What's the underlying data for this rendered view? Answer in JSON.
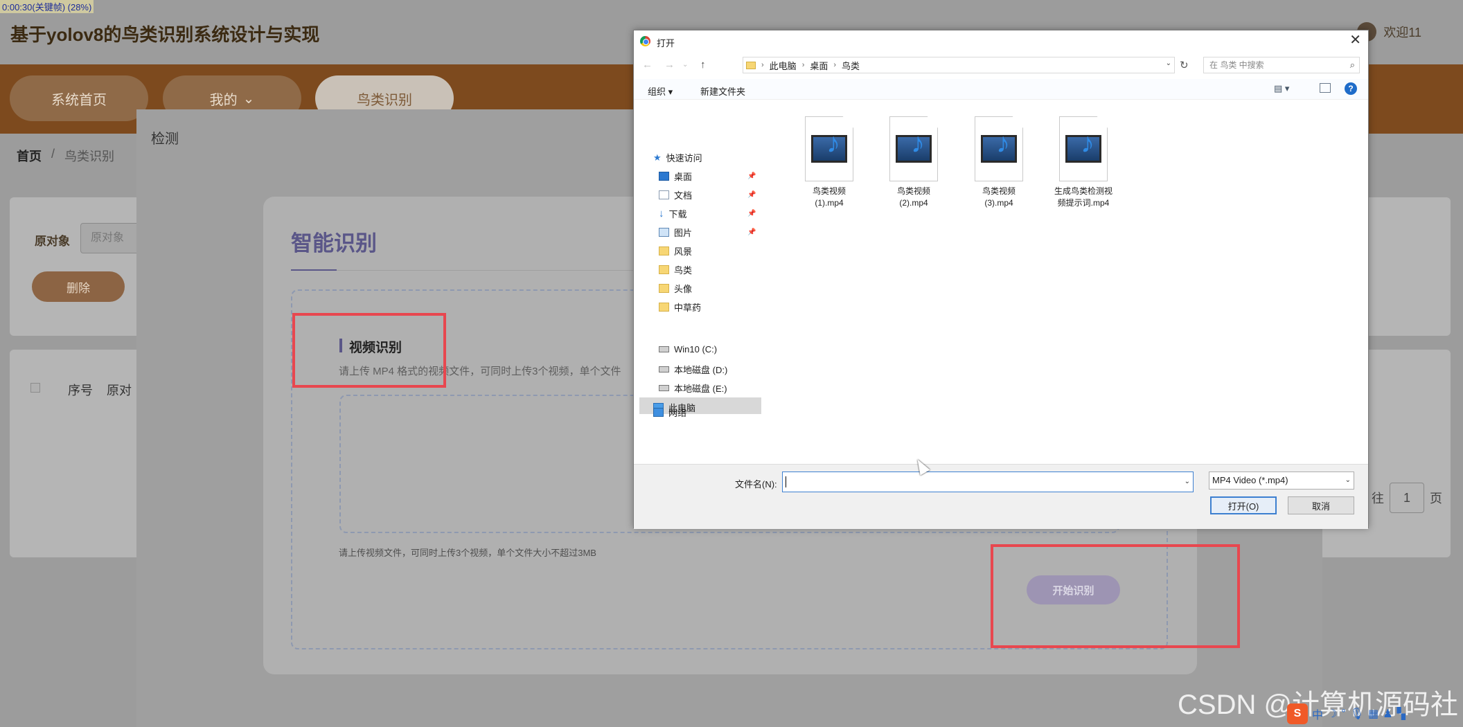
{
  "recording_label": "0:00:30(关键帧) (28%)",
  "app": {
    "title": "基于yolov8的鸟类识别系统设计与实现",
    "user_greeting": "欢迎11",
    "nav": [
      "系统首页",
      "我的",
      "鸟类识别"
    ],
    "nav_active": "鸟类识别",
    "breadcrumb": {
      "home": "首页",
      "sep": "/",
      "current": "鸟类识别"
    },
    "filter": {
      "label": "原对象",
      "placeholder": "原对象"
    },
    "delete_button": "删除",
    "table_headers": {
      "seq": "序号",
      "orig": "原对"
    },
    "pager": {
      "goto": "往",
      "page": "1",
      "suffix": "页"
    }
  },
  "detect_dialog": {
    "title": "检测",
    "smart_title": "智能识别",
    "video_label": "视频识别",
    "video_desc": "请上传 MP4 格式的视频文件，可同时上传3个视频，单个文件",
    "hint": "请上传视频文件，可同时上传3个视频，单个文件大小不超过3MB",
    "start_button": "开始识别",
    "highlight_color": "#e8474f"
  },
  "file_dialog": {
    "title": "打开",
    "path": [
      "此电脑",
      "桌面",
      "鸟类"
    ],
    "search_placeholder": "在 鸟类 中搜索",
    "toolbar": {
      "organize": "组织 ▾",
      "new_folder": "新建文件夹"
    },
    "nav": {
      "quick_access": "快速访问",
      "desktop": "桌面",
      "documents": "文档",
      "downloads": "下载",
      "pictures": "图片",
      "f1": "风景",
      "f2": "鸟类",
      "f3": "头像",
      "f4": "中草药",
      "this_pc": "此电脑",
      "drive_c": "Win10 (C:)",
      "drive_d": "本地磁盘 (D:)",
      "drive_e": "本地磁盘 (E:)",
      "network": "网络"
    },
    "files": [
      {
        "l1": "鸟类视频",
        "l2": "(1).mp4"
      },
      {
        "l1": "鸟类视频",
        "l2": "(2).mp4"
      },
      {
        "l1": "鸟类视频",
        "l2": "(3).mp4"
      },
      {
        "l1": "生成鸟类检测视",
        "l2": "频提示词.mp4"
      }
    ],
    "filename_label": "文件名(N):",
    "filename_value": "",
    "filetype": "MP4 Video (*.mp4)",
    "open_button": "打开(O)",
    "cancel_button": "取消"
  },
  "watermark": "CSDN @计算机源码社",
  "ime": {
    "logo": "S",
    "lang": "中"
  }
}
